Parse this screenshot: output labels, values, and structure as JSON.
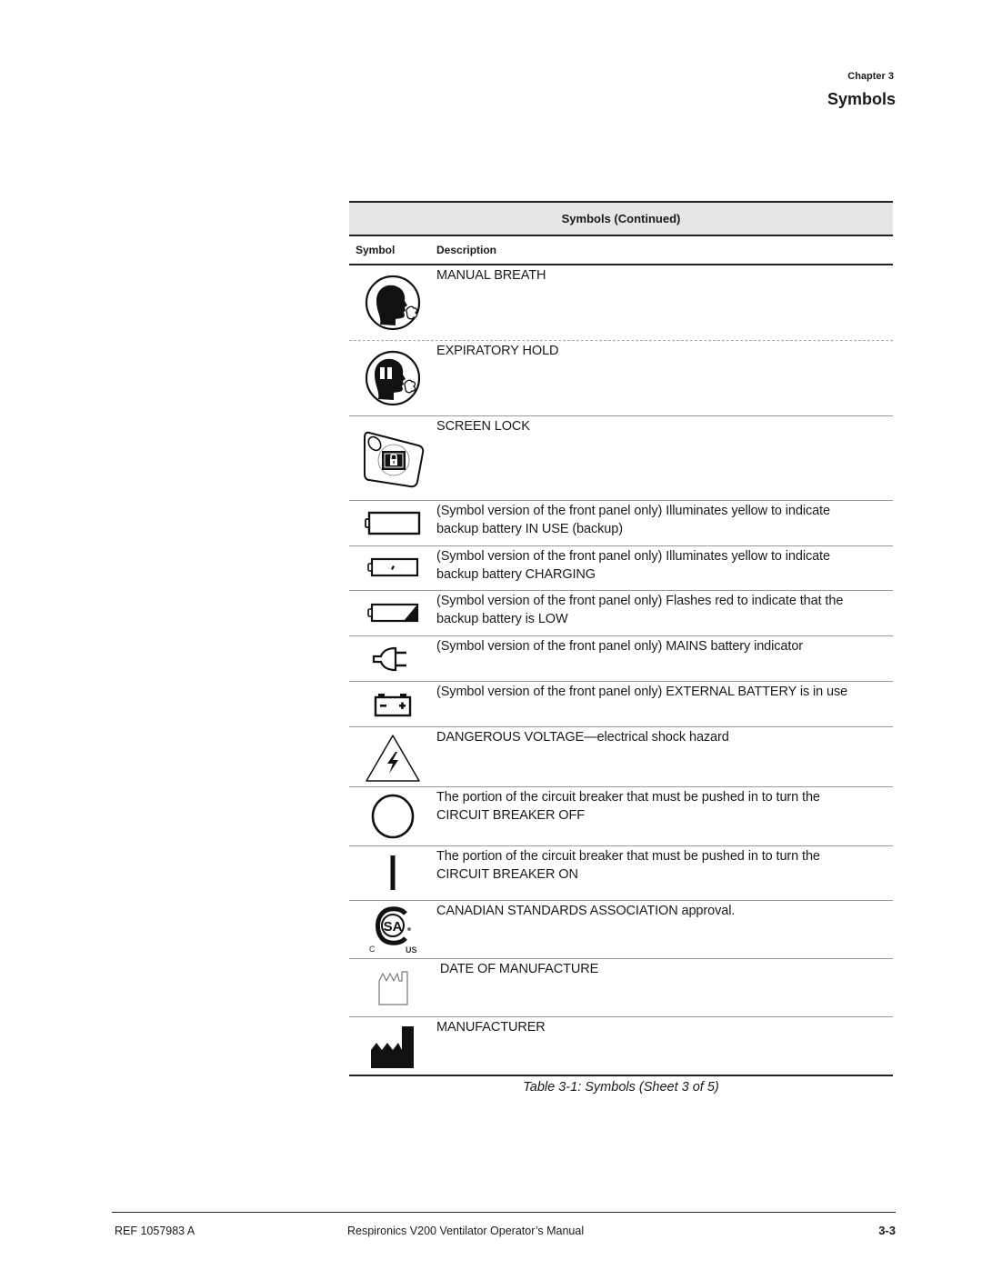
{
  "header": {
    "chapter": "Chapter 3",
    "title": "Symbols"
  },
  "table": {
    "title": "Symbols (Continued)",
    "columns": [
      "Symbol",
      "Description"
    ],
    "rows": [
      {
        "icon": "manual-breath-icon",
        "desc_lines": [
          "MANUAL BREATH"
        ]
      },
      {
        "icon": "expiratory-hold-icon",
        "desc_lines": [
          "EXPIRATORY HOLD"
        ]
      },
      {
        "icon": "screen-lock-icon",
        "desc_lines": [
          "SCREEN LOCK"
        ]
      },
      {
        "icon": "battery-in-use-icon",
        "desc_lines": [
          "(Symbol version of the front panel only) Illuminates yellow to indicate",
          "backup battery IN USE (backup)"
        ]
      },
      {
        "icon": "battery-charging-icon",
        "desc_lines": [
          "(Symbol version of the front panel only) Illuminates yellow to indicate",
          "backup battery CHARGING"
        ]
      },
      {
        "icon": "battery-low-icon",
        "desc_lines": [
          "(Symbol version of the front panel only) Flashes red to indicate that the",
          "backup battery is LOW"
        ]
      },
      {
        "icon": "mains-plug-icon",
        "desc_lines": [
          "(Symbol version of the front panel only) MAINS battery indicator"
        ]
      },
      {
        "icon": "external-battery-icon",
        "desc_lines": [
          "(Symbol version of the front panel only) EXTERNAL BATTERY is in use"
        ]
      },
      {
        "icon": "dangerous-voltage-icon",
        "desc_lines": [
          "DANGEROUS VOLTAGE—electrical shock hazard"
        ]
      },
      {
        "icon": "circuit-breaker-off-icon",
        "desc_lines": [
          "The portion of the circuit breaker that must be pushed in to turn the",
          "CIRCUIT BREAKER OFF"
        ]
      },
      {
        "icon": "circuit-breaker-on-icon",
        "desc_lines": [
          "The portion of the circuit breaker that must be pushed in to turn the",
          "CIRCUIT BREAKER ON"
        ]
      },
      {
        "icon": "csa-approval-icon",
        "desc_lines": [
          "CANADIAN STANDARDS ASSOCIATION approval."
        ],
        "icon_text": {
          "c": "C",
          "us": "US"
        }
      },
      {
        "icon": "date-of-manufacture-icon",
        "desc_lines": [
          " DATE OF MANUFACTURE"
        ]
      },
      {
        "icon": "manufacturer-icon",
        "desc_lines": [
          "MANUFACTURER"
        ]
      }
    ]
  },
  "caption": "Table 3-1: Symbols (Sheet 3 of 5)",
  "footer": {
    "ref": "REF 1057983 A",
    "title": "Respironics V200 Ventilator Operator’s Manual",
    "page": "3-3"
  }
}
